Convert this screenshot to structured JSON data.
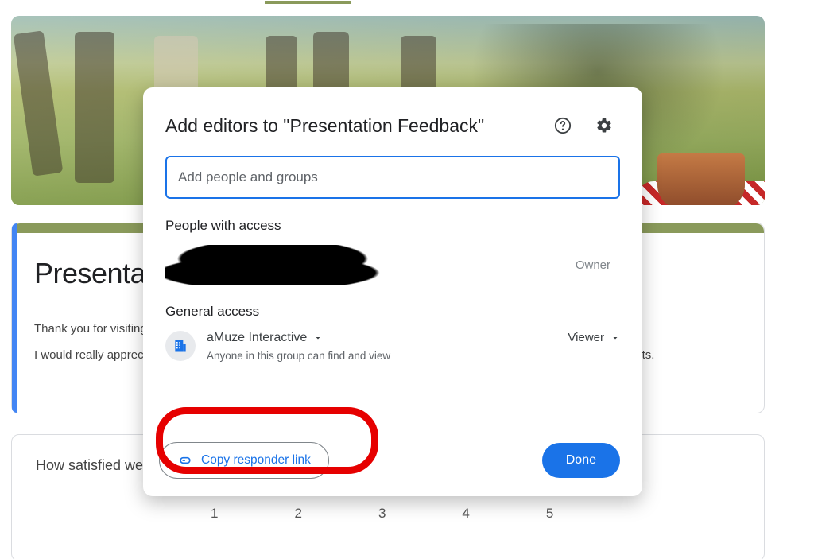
{
  "header": {
    "tab_active": true
  },
  "title_card": {
    "heading": "Presentation Feedback",
    "line1": "Thank you for visiting",
    "line2": "I would really appreciate your feedback on how well this poster i.e.  easy to understand, clear and know your thoughts."
  },
  "question_card": {
    "text": "How satisfied were you",
    "scale": [
      "1",
      "2",
      "3",
      "4",
      "5"
    ]
  },
  "dialog": {
    "title": "Add editors to \"Presentation Feedback\"",
    "input_placeholder": "Add people and groups",
    "people_with_access": "People with access",
    "owner_label": "Owner",
    "general_access": "General access",
    "org_name": "aMuze Interactive",
    "org_desc": "Anyone in this group can find and view",
    "role": "Viewer",
    "copy_link": "Copy responder link",
    "done": "Done"
  }
}
